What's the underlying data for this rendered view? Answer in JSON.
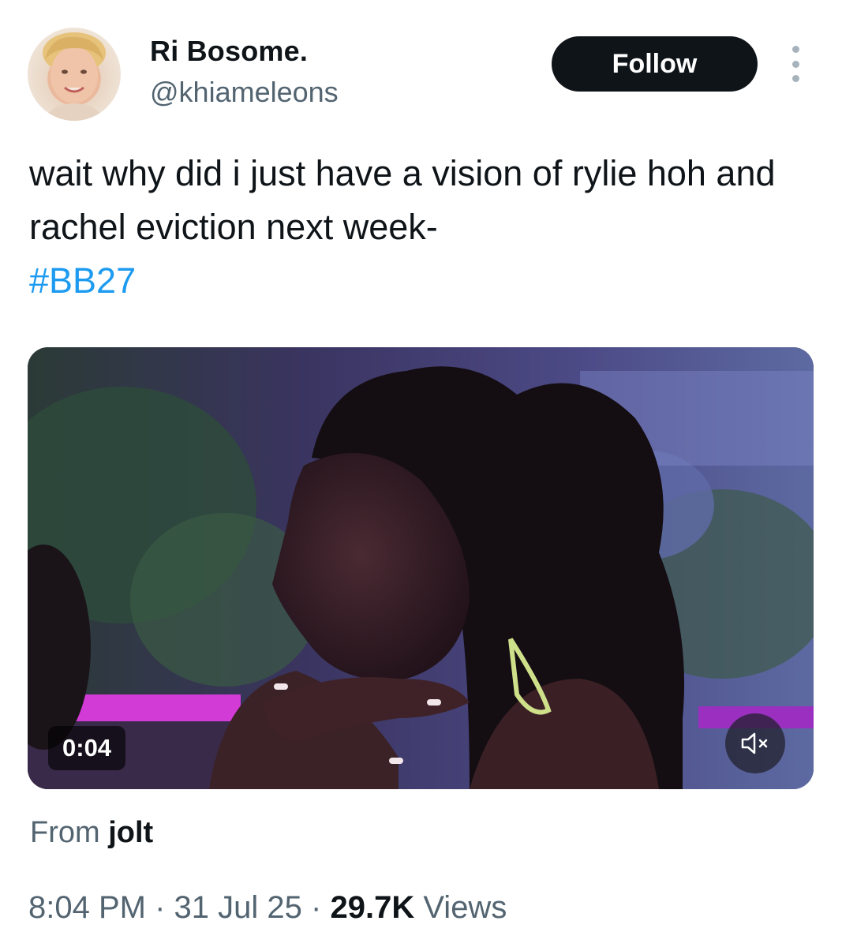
{
  "author": {
    "display_name": "Ri Bosome.",
    "handle": "@khiameleons",
    "avatar_icon": "profile-photo"
  },
  "actions": {
    "follow_label": "Follow",
    "more_icon": "more-vertical-icon"
  },
  "tweet": {
    "text": "wait why did i just have a vision of rylie hoh and rachel eviction next week-",
    "hashtag": "#BB27"
  },
  "media": {
    "type": "video",
    "duration": "0:04",
    "mute_icon": "volume-muted-icon"
  },
  "source": {
    "prefix": "From",
    "name": "jolt"
  },
  "meta": {
    "time": "8:04 PM",
    "separator": "·",
    "date": "31 Jul 25",
    "views_count": "29.7K",
    "views_label": "Views"
  },
  "colors": {
    "link": "#1d9bf0",
    "text_primary": "#0f1419",
    "text_secondary": "#536471",
    "follow_bg": "#0f1419"
  }
}
